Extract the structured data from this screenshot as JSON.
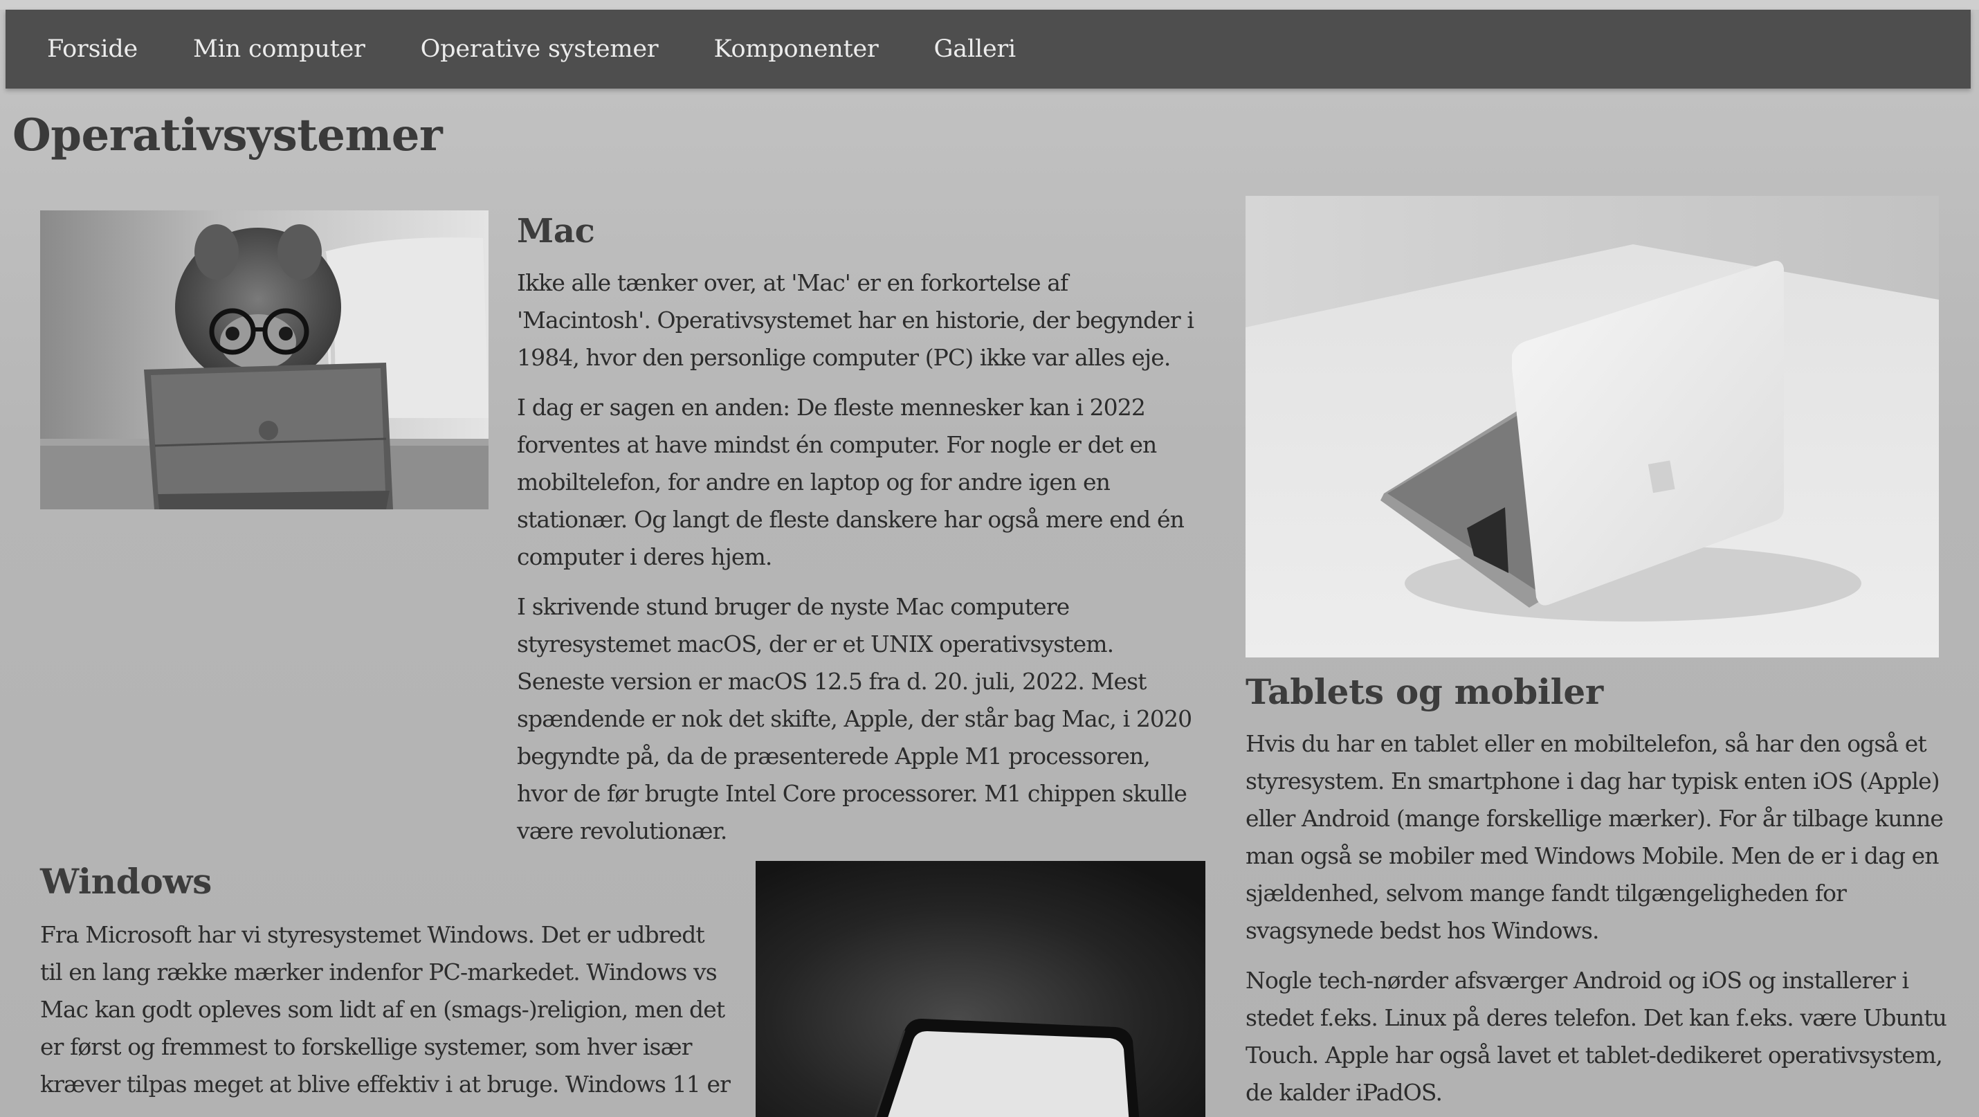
{
  "nav": {
    "items": [
      {
        "label": "Forside"
      },
      {
        "label": "Min computer"
      },
      {
        "label": "Operative systemer"
      },
      {
        "label": "Komponenter"
      },
      {
        "label": "Galleri"
      }
    ]
  },
  "page_title": "Operativsystemer",
  "mac": {
    "heading": "Mac",
    "paragraphs": [
      "Ikke alle tænker over, at 'Mac' er en forkortelse af 'Macintosh'. Operativsystemet har en historie, der begynder i 1984, hvor den personlige computer (PC) ikke var alles eje.",
      "I dag er sagen en anden: De fleste mennesker kan i 2022 forventes at have mindst én computer. For nogle er det en mobiltelefon, for andre en laptop og for andre igen en stationær. Og langt de fleste danskere har også mere end én computer i deres hjem.",
      "I skrivende stund bruger de nyste Mac computere styresystemet macOS, der er et UNIX operativsystem. Seneste version er macOS 12.5 fra d. 20. juli, 2022. Mest spændende er nok det skifte, Apple, der står bag Mac, i 2020 begyndte på, da de præsenterede Apple M1 processoren, hvor de før brugte Intel Core processorer. M1 chippen skulle være revolutionær."
    ]
  },
  "windows": {
    "heading": "Windows",
    "paragraphs": [
      "Fra Microsoft har vi styresystemet Windows. Det er udbredt til en lang række mærker indenfor PC-markedet. Windows vs Mac kan godt opleves som lidt af en (smags-)religion, men det er først og fremmest to forskellige systemer, som hver især kræver tilpas meget at blive effektiv i at bruge. Windows 11 er"
    ]
  },
  "tablets": {
    "heading": "Tablets og mobiler",
    "paragraphs": [
      "Hvis du har en tablet eller en mobiltelefon, så har den også et styresystem. En smartphone i dag har typisk enten iOS (Apple) eller Android (mange forskellige mærker). For år tilbage kunne man også se mobiler med Windows Mobile. Men de er i dag en sjældenhed, selvom mange fandt tilgængeligheden for svagsynede bedst hos Windows.",
      "Nogle tech-nørder afsværger Android og iOS og installerer i stedet f.eks. Linux på deres telefon. Det kan f.eks. være Ubuntu Touch. Apple har også lavet et tablet-dedikeret operativsystem, de kalder iPadOS."
    ]
  },
  "colors": {
    "background": "#b8b8b8",
    "navbar": "#4e4e4e",
    "nav_text": "#ececec",
    "heading": "#3c3c3c",
    "body_text": "#2c2c2c"
  }
}
